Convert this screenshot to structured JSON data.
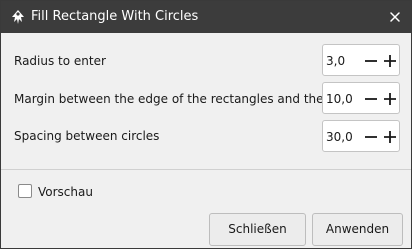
{
  "window": {
    "title": "Fill Rectangle With Circles",
    "app_icon": "inkscape-icon",
    "close_icon": "close-icon"
  },
  "params": [
    {
      "label": "Radius to enter",
      "value": "3,0"
    },
    {
      "label": "Margin between the edge of the rectangles and the circles",
      "value": "10,0"
    },
    {
      "label": "Spacing between circles",
      "value": "30,0"
    }
  ],
  "preview": {
    "label": "Vorschau",
    "checked": false
  },
  "buttons": {
    "close_label": "Schließen",
    "apply_label": "Anwenden"
  },
  "colors": {
    "titlebar": "#3c3c3c",
    "dialog_bg": "#f0f0f0",
    "text": "#1a1a1a"
  }
}
